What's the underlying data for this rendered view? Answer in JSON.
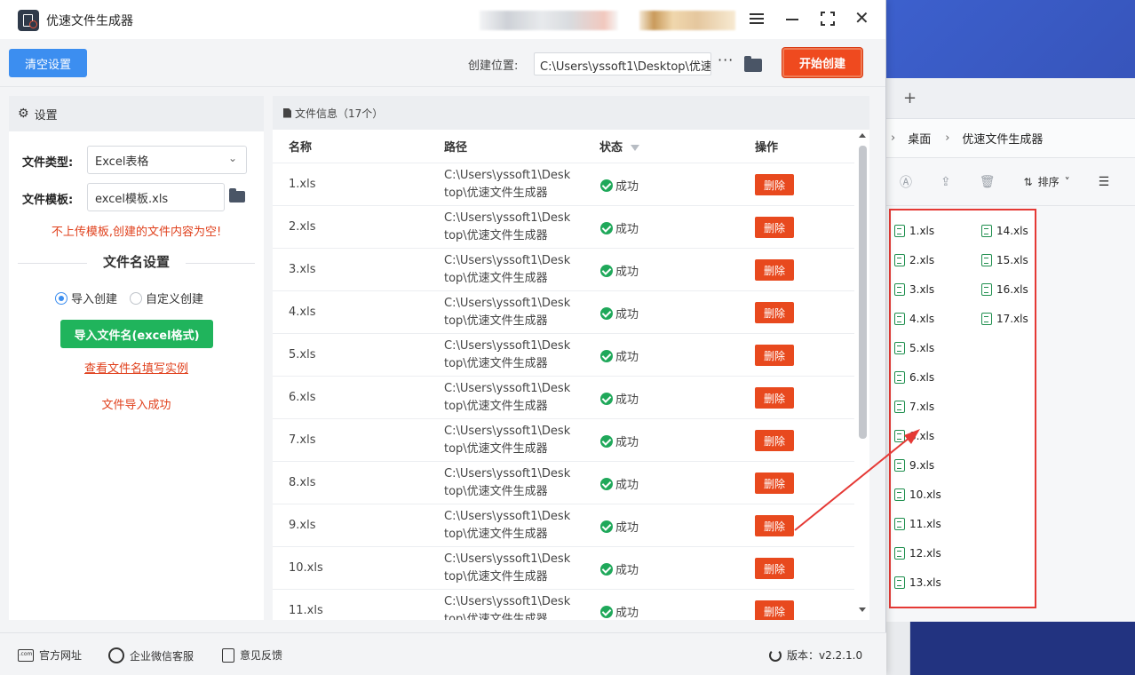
{
  "app": {
    "title": "优速文件生成器",
    "clear_button": "清空设置",
    "location_label": "创建位置:",
    "location_value": "C:\\Users\\yssoft1\\Desktop\\优速",
    "start_button": "开始创建"
  },
  "settings": {
    "header": "设置",
    "file_type_label": "文件类型:",
    "file_type_value": "Excel表格",
    "template_label": "文件模板:",
    "template_value": "excel模板.xls",
    "warning": "不上传模板,创建的文件内容为空!",
    "filename_section_title": "文件名设置",
    "radio_import": "导入创建",
    "radio_custom": "自定义创建",
    "import_button": "导入文件名(excel格式)",
    "example_link": "查看文件名填写实例",
    "import_status": "文件导入成功"
  },
  "fileinfo": {
    "header": "文件信息（17个）",
    "col_name": "名称",
    "col_path": "路径",
    "col_status": "状态",
    "col_action": "操作",
    "rows": [
      {
        "name": "1.xls",
        "path1": "C:\\Users\\yssoft1\\Desk",
        "path2": "top\\优速文件生成器",
        "status": "成功",
        "action": "删除"
      },
      {
        "name": "2.xls",
        "path1": "C:\\Users\\yssoft1\\Desk",
        "path2": "top\\优速文件生成器",
        "status": "成功",
        "action": "删除"
      },
      {
        "name": "3.xls",
        "path1": "C:\\Users\\yssoft1\\Desk",
        "path2": "top\\优速文件生成器",
        "status": "成功",
        "action": "删除"
      },
      {
        "name": "4.xls",
        "path1": "C:\\Users\\yssoft1\\Desk",
        "path2": "top\\优速文件生成器",
        "status": "成功",
        "action": "删除"
      },
      {
        "name": "5.xls",
        "path1": "C:\\Users\\yssoft1\\Desk",
        "path2": "top\\优速文件生成器",
        "status": "成功",
        "action": "删除"
      },
      {
        "name": "6.xls",
        "path1": "C:\\Users\\yssoft1\\Desk",
        "path2": "top\\优速文件生成器",
        "status": "成功",
        "action": "删除"
      },
      {
        "name": "7.xls",
        "path1": "C:\\Users\\yssoft1\\Desk",
        "path2": "top\\优速文件生成器",
        "status": "成功",
        "action": "删除"
      },
      {
        "name": "8.xls",
        "path1": "C:\\Users\\yssoft1\\Desk",
        "path2": "top\\优速文件生成器",
        "status": "成功",
        "action": "删除"
      },
      {
        "name": "9.xls",
        "path1": "C:\\Users\\yssoft1\\Desk",
        "path2": "top\\优速文件生成器",
        "status": "成功",
        "action": "删除"
      },
      {
        "name": "10.xls",
        "path1": "C:\\Users\\yssoft1\\Desk",
        "path2": "top\\优速文件生成器",
        "status": "成功",
        "action": "删除"
      },
      {
        "name": "11.xls",
        "path1": "C:\\Users\\yssoft1\\Desk",
        "path2": "top\\优速文件生成器",
        "status": "成功",
        "action": "删除"
      }
    ]
  },
  "footer": {
    "website": "官方网址",
    "wechat": "企业微信客服",
    "feedback": "意见反馈",
    "version": "版本：v2.2.1.0"
  },
  "explorer": {
    "crumb1": "桌面",
    "crumb2": "优速文件生成器",
    "sort_label": "排序",
    "files_col1": [
      "1.xls",
      "2.xls",
      "3.xls",
      "4.xls",
      "5.xls",
      "6.xls",
      "7.xls",
      "8.xls",
      "9.xls",
      "10.xls",
      "11.xls",
      "12.xls",
      "13.xls"
    ],
    "files_col2": [
      "14.xls",
      "15.xls",
      "16.xls",
      "17.xls"
    ]
  },
  "colors": {
    "primary_blue": "#3c8ef0",
    "start_orange": "#ef4a1f",
    "delete_red": "#e8491e",
    "success_green": "#1fa85a",
    "import_green": "#20b45c",
    "highlight_red": "#e53935"
  }
}
